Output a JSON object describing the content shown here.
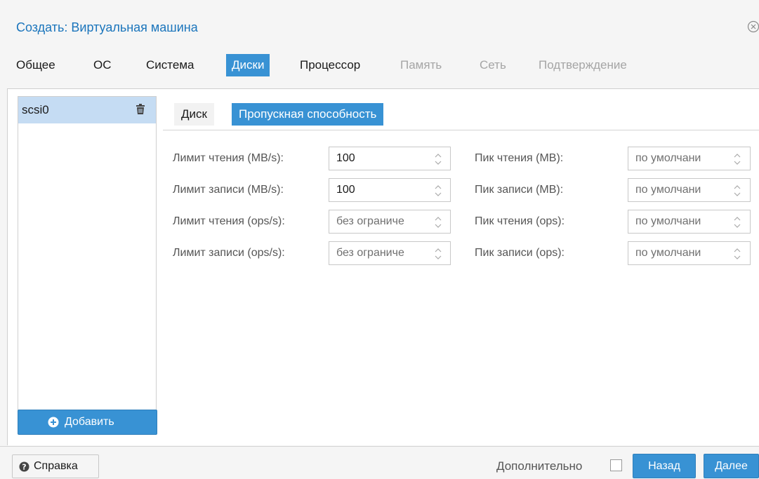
{
  "window": {
    "title": "Создать: Виртуальная машина",
    "close_icon": "close-circle-icon"
  },
  "tabs": [
    {
      "label": "Общее",
      "state": "normal"
    },
    {
      "label": "ОС",
      "state": "normal"
    },
    {
      "label": "Система",
      "state": "normal"
    },
    {
      "label": "Диски",
      "state": "active"
    },
    {
      "label": "Процессор",
      "state": "normal"
    },
    {
      "label": "Память",
      "state": "disabled"
    },
    {
      "label": "Сеть",
      "state": "disabled"
    },
    {
      "label": "Подтверждение",
      "state": "disabled"
    }
  ],
  "disks": {
    "items": [
      {
        "label": "scsi0",
        "selected": true
      }
    ],
    "add_label": "Добавить"
  },
  "subtabs": {
    "disk": "Диск",
    "bandwidth": "Пропускная способность",
    "active": "bandwidth"
  },
  "form": {
    "left": [
      {
        "label": "Лимит чтения (MB/s):",
        "value": "100",
        "placeholder": ""
      },
      {
        "label": "Лимит записи (MB/s):",
        "value": "100",
        "placeholder": ""
      },
      {
        "label": "Лимит чтения (ops/s):",
        "value": "",
        "placeholder": "без ограниче"
      },
      {
        "label": "Лимит записи (ops/s):",
        "value": "",
        "placeholder": "без ограниче"
      }
    ],
    "right": [
      {
        "label": "Пик чтения (MB):",
        "value": "",
        "placeholder": "по умолчани"
      },
      {
        "label": "Пик записи (MB):",
        "value": "",
        "placeholder": "по умолчани"
      },
      {
        "label": "Пик чтения (ops):",
        "value": "",
        "placeholder": "по умолчани"
      },
      {
        "label": "Пик записи (ops):",
        "value": "",
        "placeholder": "по умолчани"
      }
    ]
  },
  "footer": {
    "help_label": "Справка",
    "advanced_label": "Дополнительно",
    "advanced_checked": false,
    "back_label": "Назад",
    "next_label": "Далее"
  },
  "colors": {
    "accent": "#3892d4",
    "title": "#1b75bc",
    "selected_row": "#c5dcf3"
  }
}
